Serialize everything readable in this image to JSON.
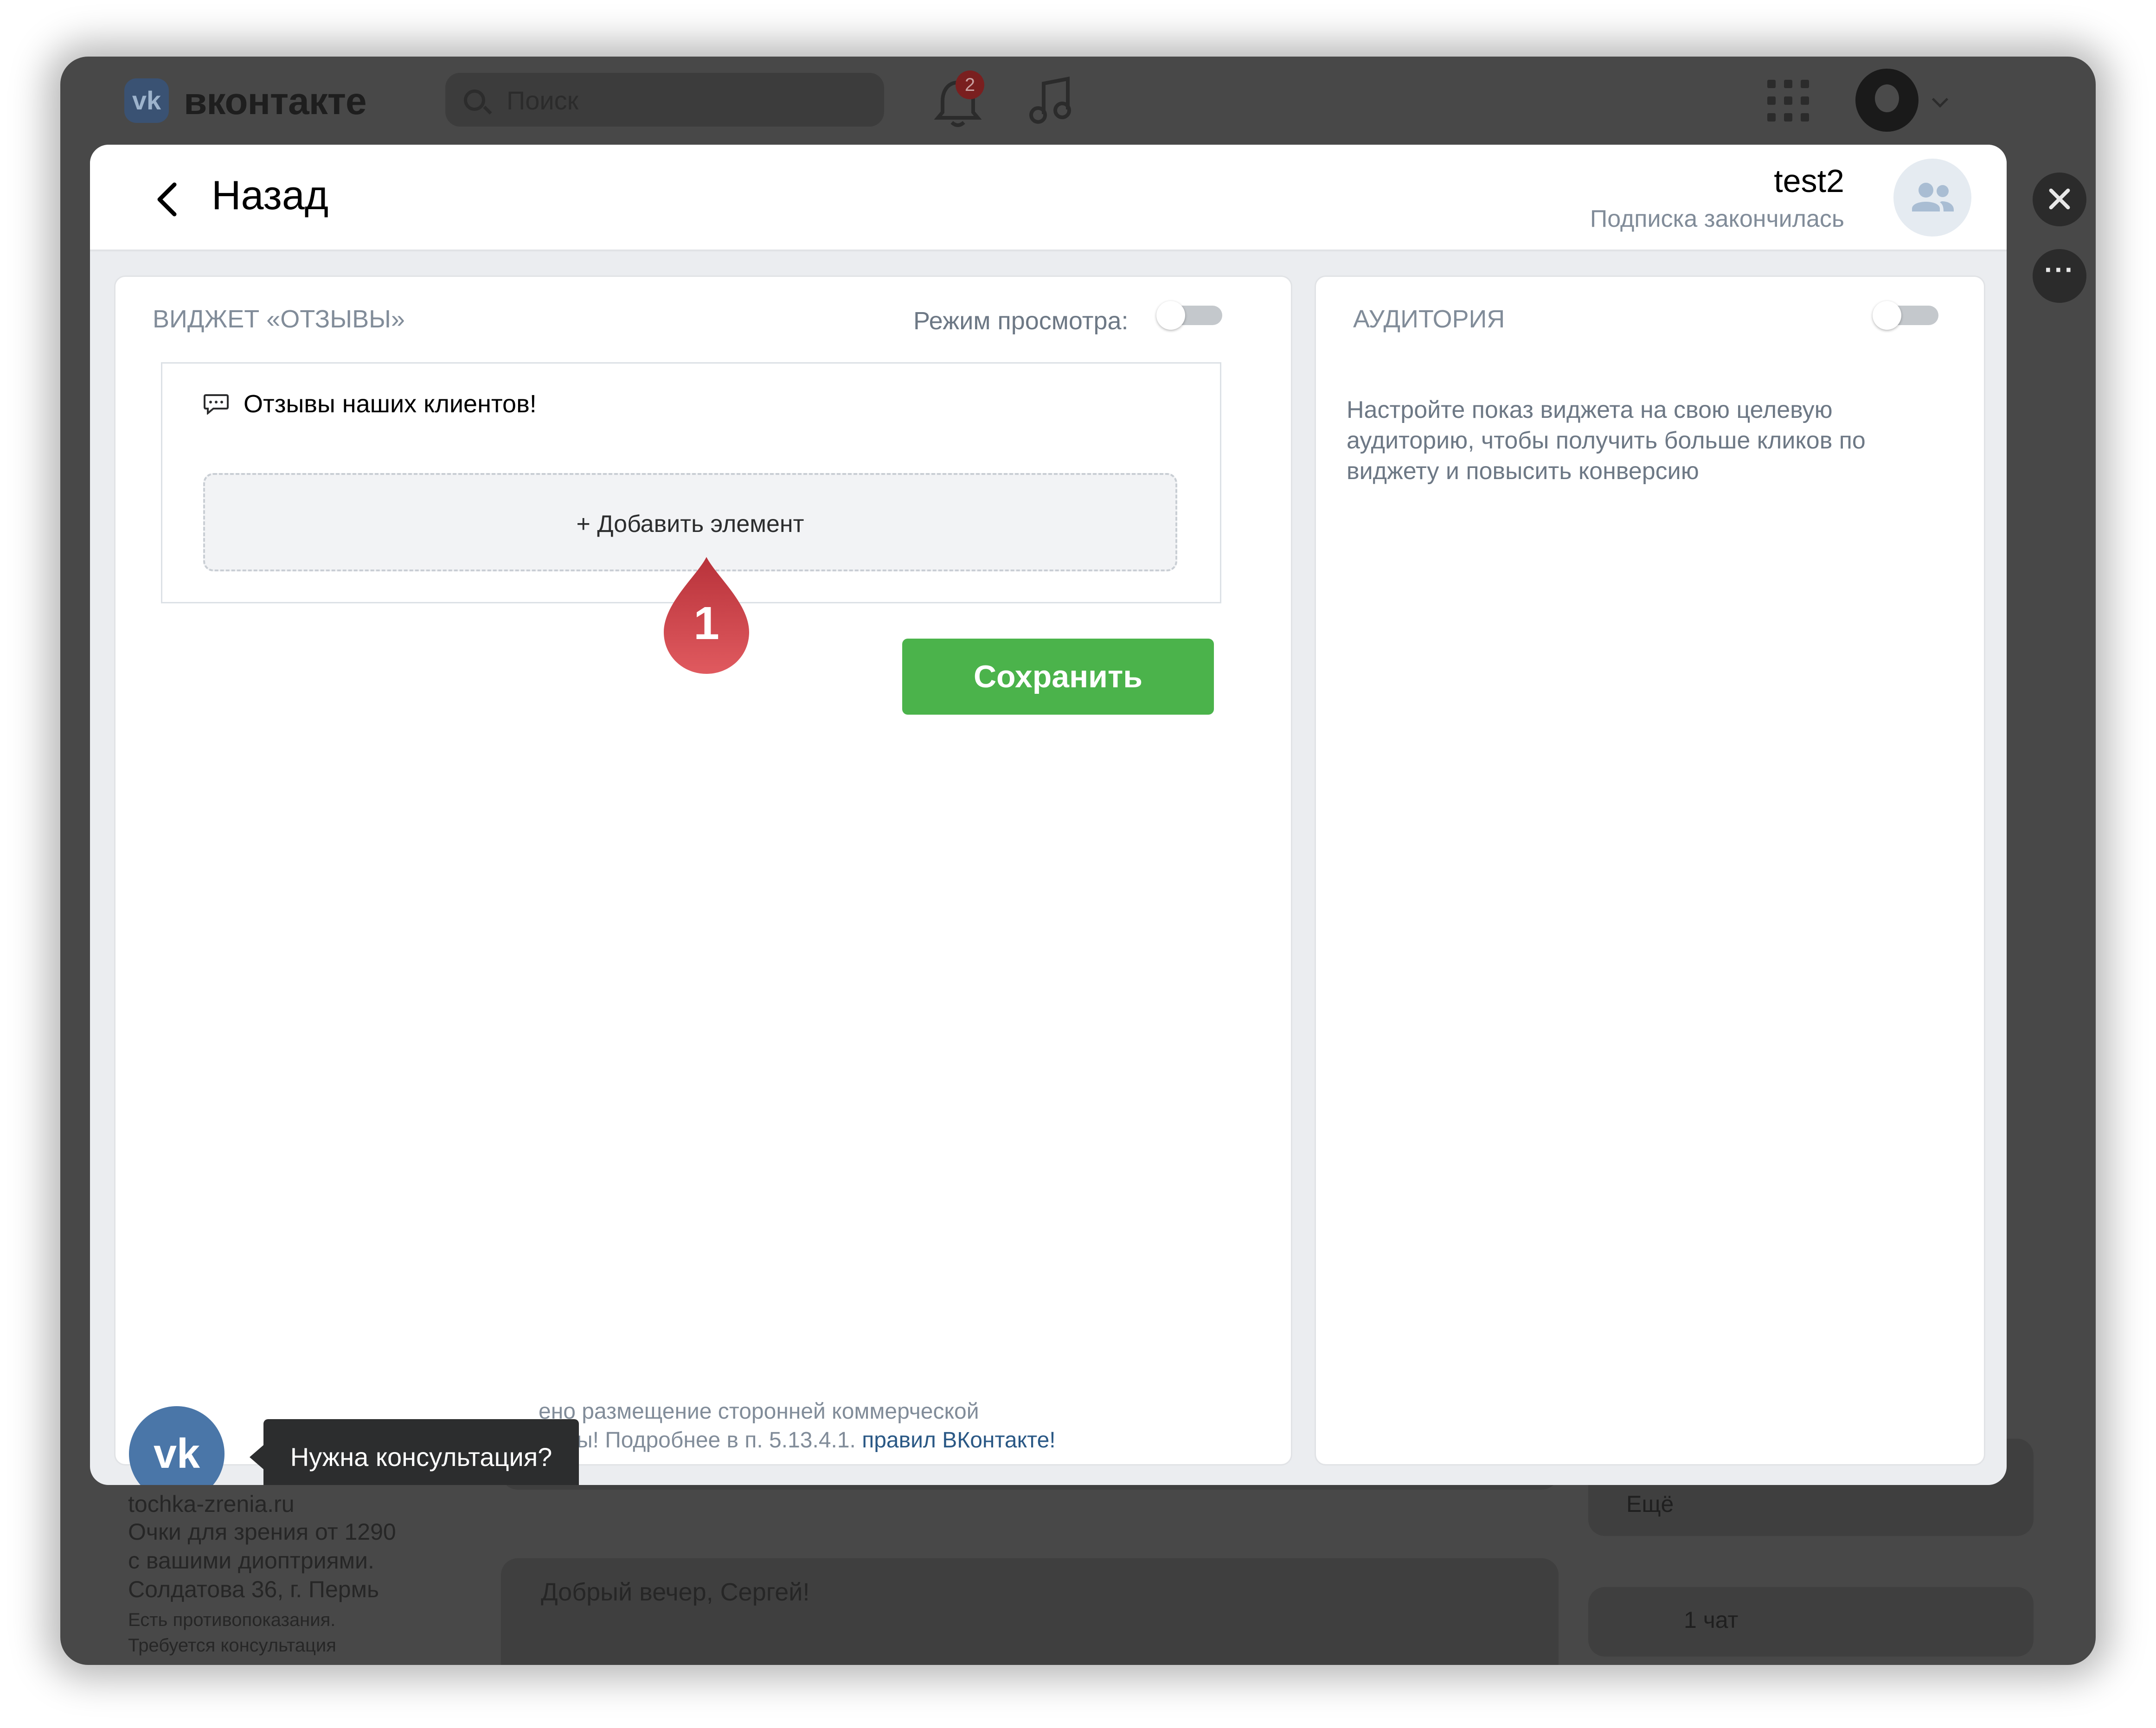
{
  "topbar": {
    "brand": "вконтакте",
    "logo_text": "vk",
    "search_placeholder": "Поиск",
    "notifications_count": "2"
  },
  "modal": {
    "back_label": "Назад",
    "group_name": "test2",
    "group_status": "Подписка закончилась"
  },
  "widget": {
    "title": "ВИДЖЕТ «ОТЗЫВЫ»",
    "mode_label": "Режим просмотра:",
    "view_mode_on": false,
    "box_title": "Отзывы наших клиентов!",
    "add_element_label": "+  Добавить элемент",
    "save_label": "Сохранить",
    "marker_number": "1",
    "footer_line1": "ено размещение сторонней коммерческой",
    "footer_line2_prefix": "и политической рекламы! Подробнее в п. 5.13.4.1. ",
    "footer_link": "правил ВКонтакте!"
  },
  "audience": {
    "title": "АУДИТОРИЯ",
    "enabled": false,
    "description": "Настройте показ виджета на свою целевую аудиторию, чтобы получить больше кликов по виджету и повысить конверсию"
  },
  "consult": {
    "logo_text": "vk",
    "tooltip": "Нужна консультация?"
  },
  "background_page": {
    "ad_domain": "tochka-zrenia.ru",
    "ad_text_1": "Очки для зрения от 1290",
    "ad_text_2": "с вашими диоптриями.",
    "ad_text_3": "Солдатова 36, г. Пермь",
    "ad_note_1": "Есть противопоказания.",
    "ad_note_2": "Требуется консультация",
    "greeting": "Добрый вечер, Сергей!",
    "more_label": "Ещё",
    "chat_label": "1 чат"
  },
  "colors": {
    "accent_green": "#4bb34b",
    "vk_blue": "#4a76a8",
    "marker_red": "#d9434a"
  }
}
